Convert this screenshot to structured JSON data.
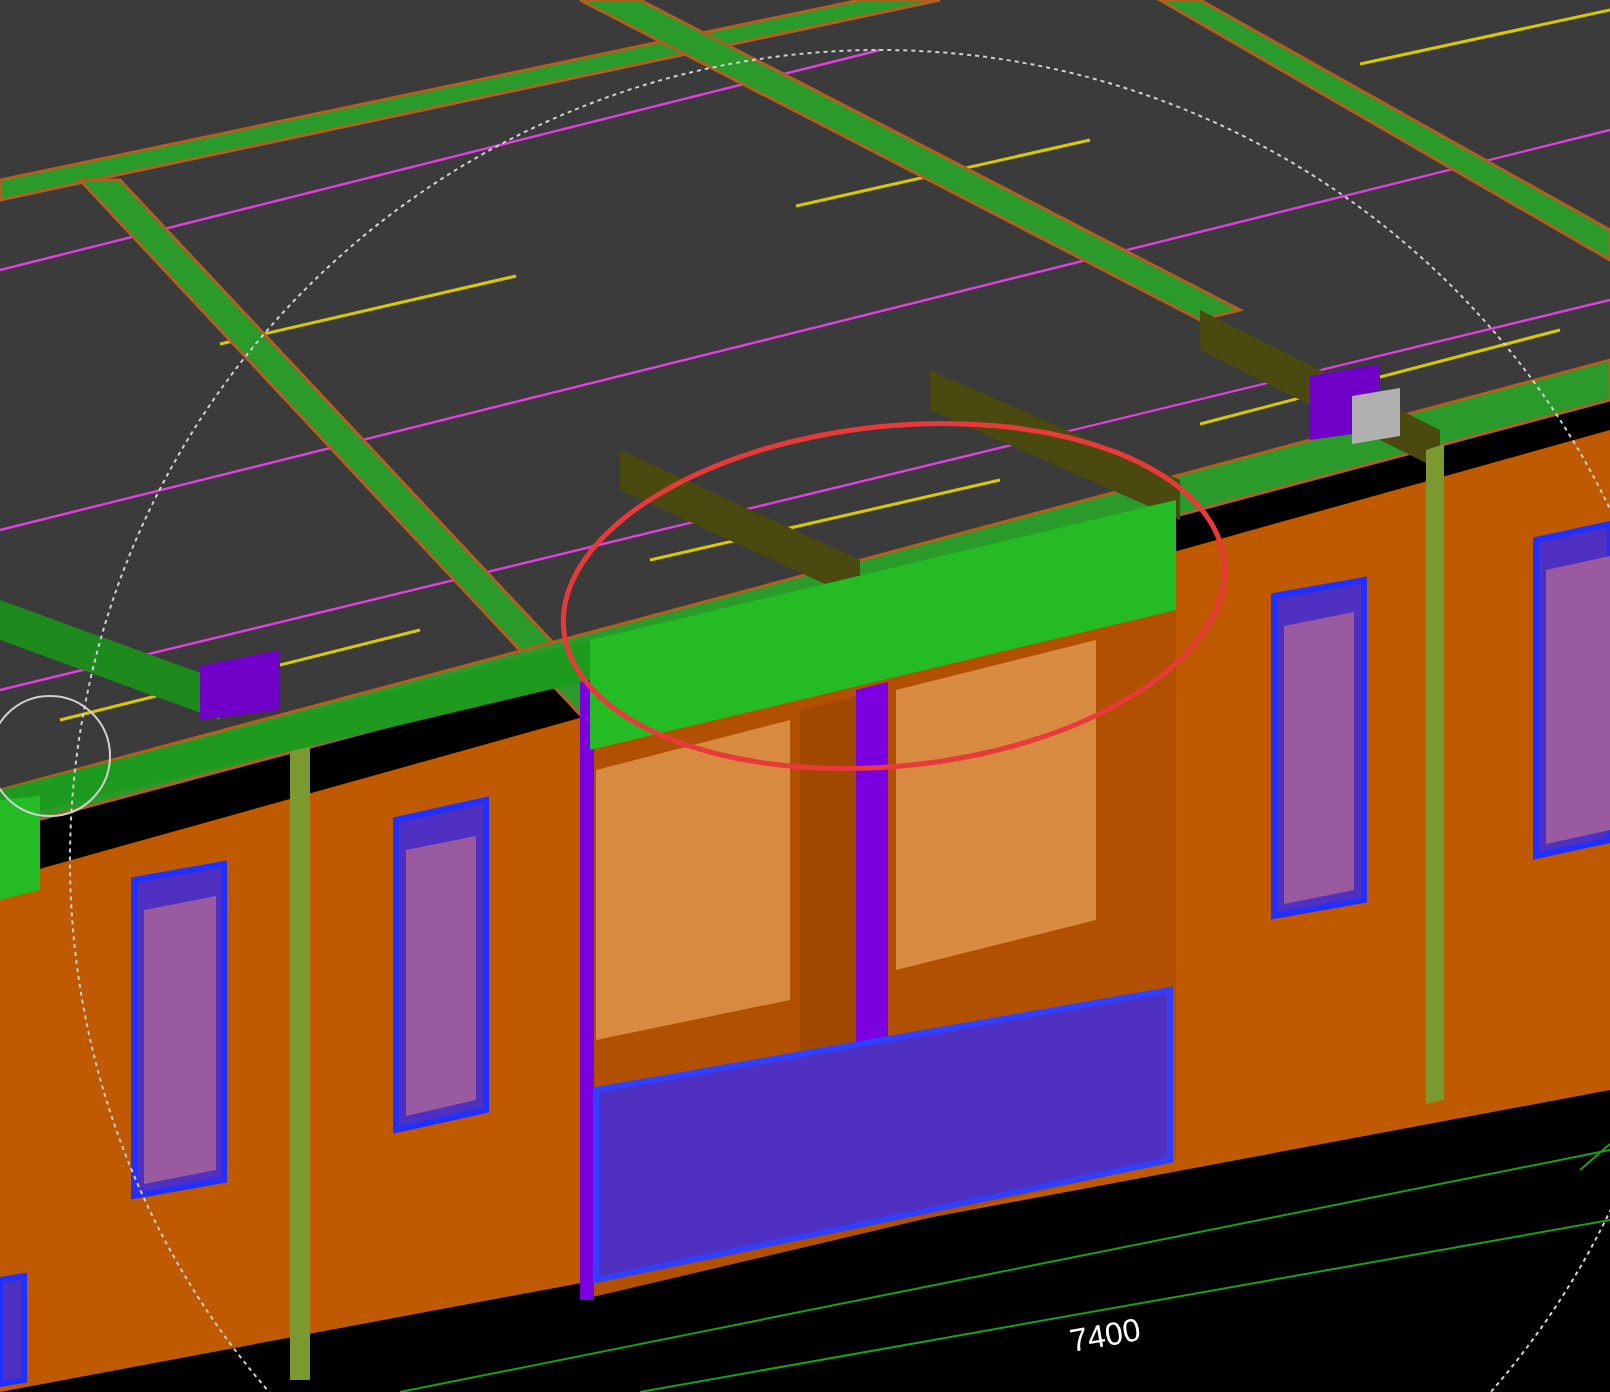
{
  "viewport": {
    "dimension_label": "7400"
  }
}
